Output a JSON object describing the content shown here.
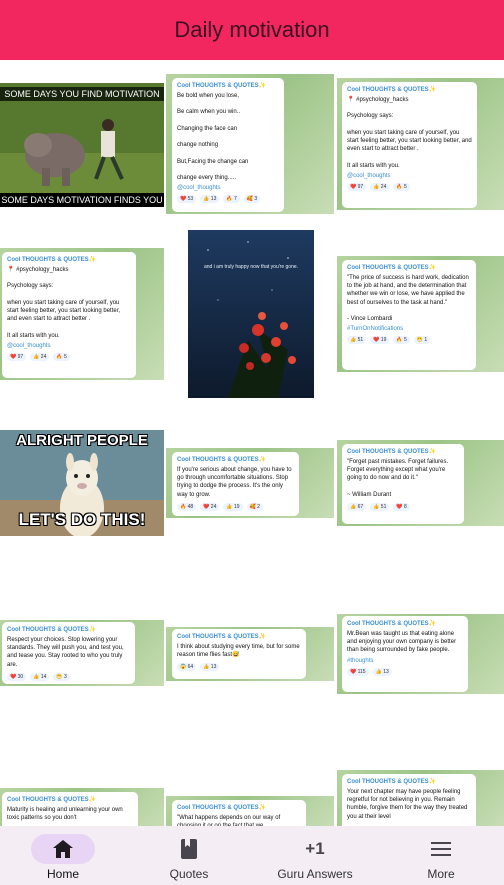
{
  "appbar": {
    "title": "Daily motivation",
    "bg_color": "#f2275f"
  },
  "photos": {
    "hippo": {
      "top_caption": "SOME DAYS YOU FIND MOTIVATION",
      "bottom_caption": "SOME DAYS MOTIVATION FINDS YOU"
    },
    "night": {
      "caption": "and i am truly happy now that you're gone."
    },
    "llama": {
      "top_caption": "ALRIGHT PEOPLE",
      "bottom_caption": "LET'S DO THIS!"
    }
  },
  "cards": [
    {
      "channel": "Cool THOUGHTS & QUOTES✨",
      "text": "Be bold when you lose,\n\nBe calm when you win..\n\nChanging the face can\n\nchange nothing\n\nBut,Facing the change can\n\nchange every thing.....",
      "tag": "@cool_thoughts",
      "reactions": [
        "❤️ 53",
        "👍 13",
        "🔥 7",
        "🥰 3"
      ]
    },
    {
      "channel": "Cool THOUGHTS & QUOTES✨",
      "text": "📍 #psychology_hacks\n\nPsychology says:\n\n when you start taking care of yourself, you start feeling better, you start looking better, and even start to attract better .\n\nIt all starts with you.",
      "tag": "@cool_thoughts",
      "reactions": [
        "❤️ 97",
        "👍 24",
        "🔥 5"
      ]
    },
    {
      "channel": "Cool THOUGHTS & QUOTES✨",
      "text": "📍 #psychology_hacks\n\nPsychology says:\n\n when you start taking care of yourself, you start feeling better, you start looking better, and even start to attract better .\n\nIt all starts with you.",
      "tag": "@cool_thoughts",
      "reactions": [
        "❤️ 97",
        "👍 24",
        "🔥 5"
      ]
    },
    {
      "channel": "Cool THOUGHTS & QUOTES✨",
      "text": "\"The price of success is hard work, dedication to the job at hand, and the determination that whether we win or lose, we have applied the best of ourselves to the task at hand.\"\n\n- Vince Lombardi",
      "tag": "#TurnOnNotifications",
      "reactions": [
        "👍 51",
        "❤️ 19",
        "🔥 5",
        "😁 1"
      ]
    },
    {
      "channel": "Cool THOUGHTS & QUOTES✨",
      "text": "If you're serious about change, you have to go through uncomfortable situations. Stop trying to dodge the process. It's the only way to grow.",
      "tag": "",
      "reactions": [
        "🔥 48",
        "❤️ 24",
        "👍 19",
        "🥰 2"
      ]
    },
    {
      "channel": "Cool THOUGHTS & QUOTES✨",
      "text": "\"Forget past mistakes. Forget failures. Forget everything except what you're going to do now and do it.\"\n\n~ William Durant",
      "tag": "",
      "reactions": [
        "👍 67",
        "👍 51",
        "❤️ 8"
      ]
    },
    {
      "channel": "Cool THOUGHTS & QUOTES✨",
      "text": "Respect your choices. Stop lowering your standards. They will push you, and  test you, and tease you. Stay rooted to who you truly are.",
      "tag": "",
      "reactions": [
        "❤️ 30",
        "👍 14",
        "😁 3"
      ]
    },
    {
      "channel": "Cool THOUGHTS & QUOTES✨",
      "text": "I think about studying every time, but for some reason time flies fast😅",
      "tag": "",
      "reactions": [
        "😱 64",
        "👍 13"
      ]
    },
    {
      "channel": "Cool THOUGHTS & QUOTES✨",
      "text": "Mr.Bean was taught us that eating alone and enjoying your own company is better than being surrounded by fake people.",
      "tag": "#thoughts",
      "reactions": [
        "❤️ 115",
        "👍 13"
      ]
    },
    {
      "channel": "Cool THOUGHTS & QUOTES✨",
      "text": "Maturity is healing and unlearning your own toxic patterns so you don't",
      "tag": "",
      "reactions": []
    },
    {
      "channel": "Cool THOUGHTS & QUOTES✨",
      "text": "\"What happens depends on our way of choosing it or on the fact that we",
      "tag": "",
      "reactions": []
    },
    {
      "channel": "Cool THOUGHTS & QUOTES✨",
      "text": "Your next chapter may have people feeling regretful for not believing in you. Remain humble, forgive them for the way they treated you at their level",
      "tag": "",
      "reactions": []
    }
  ],
  "nav": {
    "items": [
      {
        "label": "Home",
        "icon": "home-icon"
      },
      {
        "label": "Quotes",
        "icon": "book-icon"
      },
      {
        "label": "Guru Answers",
        "icon": "plus-one-icon"
      },
      {
        "label": "More",
        "icon": "menu-icon"
      }
    ],
    "plus_one_glyph": "+1",
    "active": "Home"
  }
}
